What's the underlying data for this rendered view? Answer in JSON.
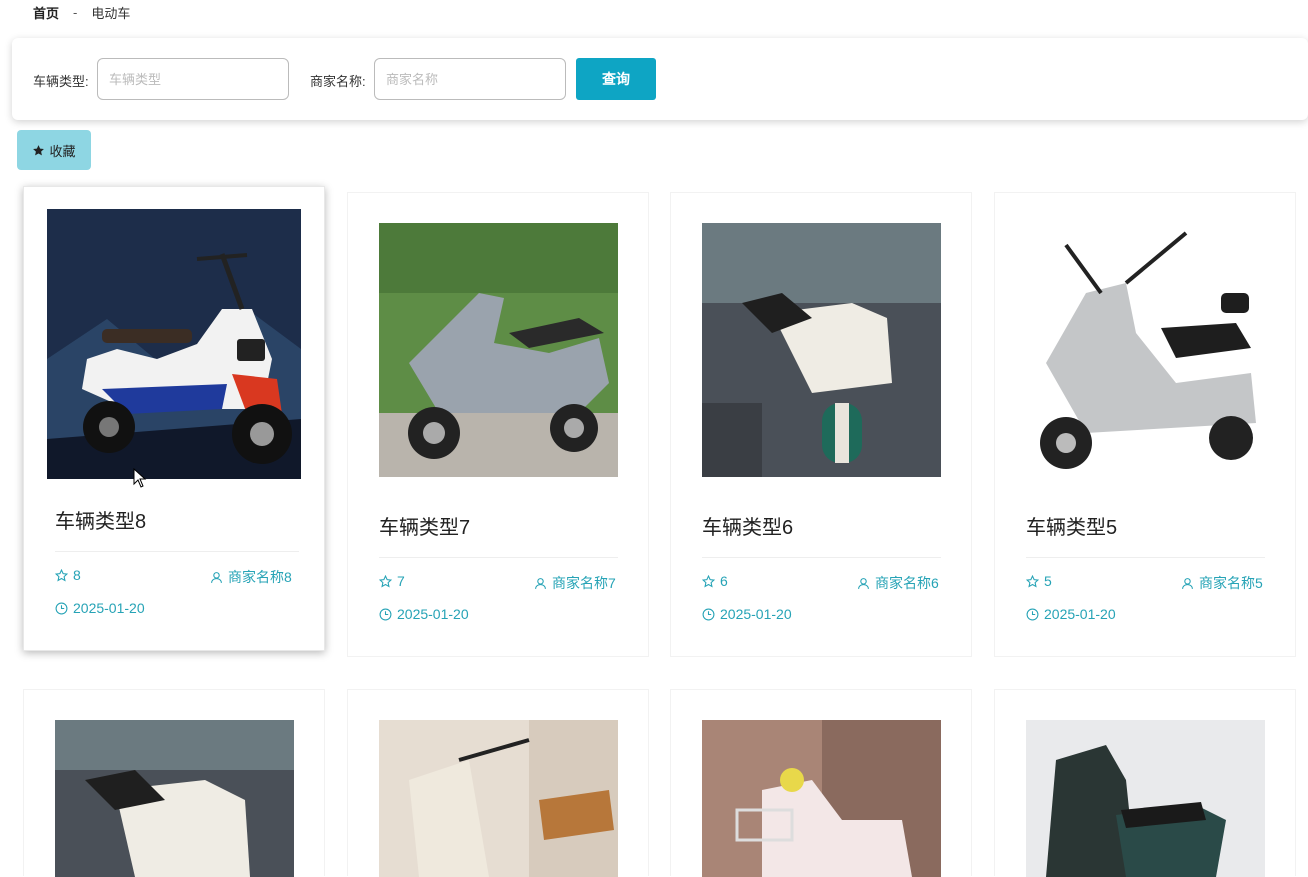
{
  "breadcrumb": {
    "home": "首页",
    "separator": "-",
    "current": "电动车"
  },
  "search": {
    "type_label": "车辆类型:",
    "type_placeholder": "车辆类型",
    "merchant_label": "商家名称:",
    "merchant_placeholder": "商家名称",
    "query_button": "查询"
  },
  "favorite_button": "收藏",
  "colors": {
    "accent": "#0ea5c4",
    "meta_text": "#26a3b6",
    "fav_bg": "#8ed6e3"
  },
  "cards": [
    {
      "title": "车辆类型8",
      "favorites": "8",
      "merchant": "商家名称8",
      "date": "2025-01-20"
    },
    {
      "title": "车辆类型7",
      "favorites": "7",
      "merchant": "商家名称7",
      "date": "2025-01-20"
    },
    {
      "title": "车辆类型6",
      "favorites": "6",
      "merchant": "商家名称6",
      "date": "2025-01-20"
    },
    {
      "title": "车辆类型5",
      "favorites": "5",
      "merchant": "商家名称5",
      "date": "2025-01-20"
    }
  ]
}
